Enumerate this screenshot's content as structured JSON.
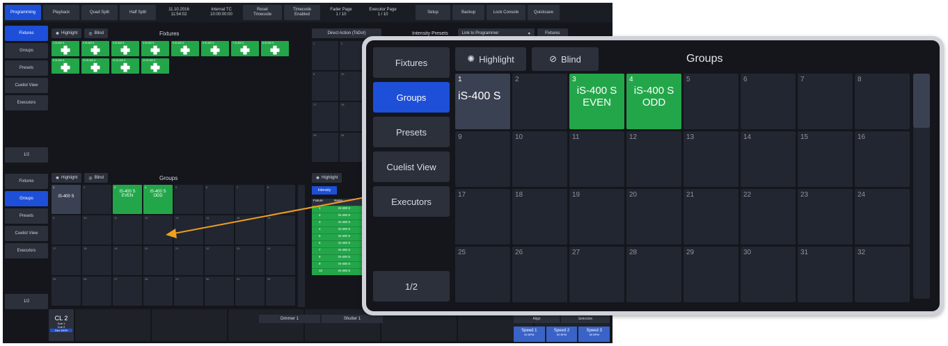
{
  "topbar": [
    {
      "label": "Programming",
      "active": true
    },
    {
      "label": "Playback"
    },
    {
      "label": "Quad Split"
    },
    {
      "label": "Half Split"
    },
    {
      "label": "11.10.2016\n11:54:02",
      "info": true
    },
    {
      "label": "Internal TC\n10:00:00:00",
      "info": true
    },
    {
      "label": "Reset\nTimecode"
    },
    {
      "label": "Timecode\nEnabled"
    },
    {
      "label": "Fader Page\n1 / 10",
      "info": true
    },
    {
      "label": "Executor Page\n1 / 10",
      "info": true
    },
    {
      "label": "Setup"
    },
    {
      "label": "Backup"
    },
    {
      "label": "Lock Console"
    },
    {
      "label": "Quicksave"
    }
  ],
  "upper_sidebar": [
    "Fixtures",
    "Groups",
    "Presets",
    "Cuelist View",
    "Executors"
  ],
  "upper_sidebar_page": "1/2",
  "lower_sidebar": [
    "Fixtures",
    "Groups",
    "Presets",
    "Cuelist View",
    "Executors"
  ],
  "lower_sidebar_page": "1/2",
  "fixtures_panel": {
    "highlight": "Highlight",
    "blind": "Blind",
    "title": "Fixtures",
    "items": [
      {
        "n": "1",
        "name": "iS-400 S"
      },
      {
        "n": "2",
        "name": "iS-400 S"
      },
      {
        "n": "3",
        "name": "iS-400 S"
      },
      {
        "n": "4",
        "name": "iS-400 S"
      },
      {
        "n": "5",
        "name": "iS-400 S"
      },
      {
        "n": "6",
        "name": "iS-400 S"
      },
      {
        "n": "7",
        "name": "iS-400 S"
      },
      {
        "n": "8",
        "name": "iS-400 S"
      },
      {
        "n": "9",
        "name": "iS-400 S"
      },
      {
        "n": "10",
        "name": "iS-400 S"
      },
      {
        "n": "11",
        "name": "iS-400 S"
      },
      {
        "n": "12",
        "name": "iS-400 S"
      }
    ]
  },
  "presets_header": {
    "direct_action": "Direct Action (ToDo!)",
    "title": "Intensity Presets",
    "link": "Link to Programmer",
    "fixtures_btn": "Fixtures"
  },
  "preset_numbers": [
    "1",
    "2",
    "9",
    "10",
    "17",
    "18",
    "25",
    "26"
  ],
  "groups_small": {
    "highlight": "Highlight",
    "blind": "Blind",
    "title": "Groups",
    "cells": [
      {
        "n": "1",
        "name": "iS-400 S",
        "style": "sel"
      },
      {
        "n": "2"
      },
      {
        "n": "3",
        "name": "iS-400 S\nEVEN",
        "style": "green"
      },
      {
        "n": "4",
        "name": "iS-400 S\nODD",
        "style": "green"
      },
      {
        "n": "5"
      },
      {
        "n": "6"
      },
      {
        "n": "7"
      },
      {
        "n": "8"
      },
      {
        "n": "9"
      },
      {
        "n": "10"
      },
      {
        "n": "11"
      },
      {
        "n": "12"
      },
      {
        "n": "13"
      },
      {
        "n": "14"
      },
      {
        "n": "15"
      },
      {
        "n": "16"
      },
      {
        "n": "17"
      },
      {
        "n": "18"
      },
      {
        "n": "19"
      },
      {
        "n": "20"
      },
      {
        "n": "21"
      },
      {
        "n": "22"
      },
      {
        "n": "23"
      },
      {
        "n": "24"
      },
      {
        "n": "25"
      },
      {
        "n": "26"
      },
      {
        "n": "27"
      },
      {
        "n": "28"
      },
      {
        "n": "29"
      },
      {
        "n": "30"
      },
      {
        "n": "31"
      },
      {
        "n": "32"
      }
    ]
  },
  "intensity_table": {
    "highlight": "Highlight",
    "tab": "Intensity",
    "col_fixture": "Fixture",
    "col_name": "Name",
    "rows": [
      {
        "f": "1",
        "name": "iS-400 S"
      },
      {
        "f": "2",
        "name": "iS-400 S"
      },
      {
        "f": "3",
        "name": "iS-400 S"
      },
      {
        "f": "4",
        "name": "iS-400 S"
      },
      {
        "f": "5",
        "name": "iS-400 S"
      },
      {
        "f": "6",
        "name": "iS-400 S"
      },
      {
        "f": "7",
        "name": "iS-400 S"
      },
      {
        "f": "8",
        "name": "iS-400 S"
      },
      {
        "f": "9",
        "name": "iS-400 S"
      },
      {
        "f": "10",
        "name": "iS-400 S"
      }
    ]
  },
  "bottom": {
    "cue_header": "CL 2",
    "cue_lines": [
      "Cue 1",
      "Cue 2",
      "Dim 100%"
    ],
    "dimmer": "Dimmer 1",
    "shutter": "Shutter 1",
    "align": "Align",
    "selection": "Selection",
    "speeds": [
      {
        "label": "Speed 1",
        "bpm": "60 BPM"
      },
      {
        "label": "Speed 2",
        "bpm": "60 BPM"
      },
      {
        "label": "Speed 3",
        "bpm": "60 BPM"
      }
    ]
  },
  "zoom": {
    "sidebar": [
      "Fixtures",
      "Groups",
      "Presets",
      "Cuelist View",
      "Executors"
    ],
    "active": "Groups",
    "page": "1/2",
    "highlight": "Highlight",
    "blind": "Blind",
    "title": "Groups",
    "cells": [
      {
        "n": "1",
        "name": "iS-400 S",
        "style": "sel"
      },
      {
        "n": "2"
      },
      {
        "n": "3",
        "name": "iS-400 S\nEVEN",
        "style": "green"
      },
      {
        "n": "4",
        "name": "iS-400 S\nODD",
        "style": "green"
      },
      {
        "n": "5"
      },
      {
        "n": "6"
      },
      {
        "n": "7"
      },
      {
        "n": "8"
      },
      {
        "n": "9"
      },
      {
        "n": "10"
      },
      {
        "n": "11"
      },
      {
        "n": "12"
      },
      {
        "n": "13"
      },
      {
        "n": "14"
      },
      {
        "n": "15"
      },
      {
        "n": "16"
      },
      {
        "n": "17"
      },
      {
        "n": "18"
      },
      {
        "n": "19"
      },
      {
        "n": "20"
      },
      {
        "n": "21"
      },
      {
        "n": "22"
      },
      {
        "n": "23"
      },
      {
        "n": "24"
      },
      {
        "n": "25"
      },
      {
        "n": "26"
      },
      {
        "n": "27"
      },
      {
        "n": "28"
      },
      {
        "n": "29"
      },
      {
        "n": "30"
      },
      {
        "n": "31"
      },
      {
        "n": "32"
      }
    ]
  },
  "colors": {
    "accent": "#1d4fd8",
    "green": "#23a64a",
    "arrow": "#f0a020",
    "panel": "#14161c"
  }
}
